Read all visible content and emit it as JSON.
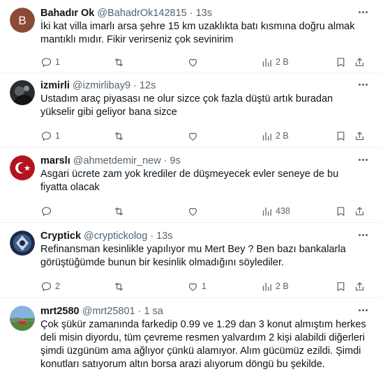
{
  "tweets": [
    {
      "name": "Bahadır Ok",
      "handle": "@BahadrOk142815",
      "time": "13s",
      "avatar_letter": "B",
      "text": "İki kat villa imarlı arsa şehre 15 km uzaklıkta batı kısmına doğru almak mantıklı mıdır. Fikir verirseniz çok sevinirim",
      "replies": "1",
      "retweets": "",
      "likes": "",
      "views": "2 B"
    },
    {
      "name": "izmirli",
      "handle": "@izmirlibay9",
      "time": "12s",
      "text": "Ustadım araç piyasası ne olur sizce çok fazla düştü artık buradan yükselir gibi geliyor bana sizce",
      "replies": "1",
      "retweets": "",
      "likes": "",
      "views": "2 B"
    },
    {
      "name": "marslı",
      "handle": "@ahmetdemir_new",
      "time": "9s",
      "text": "Asgari ücrete zam yok krediler de düşmeyecek evler seneye de bu fiyatta olacak",
      "replies": "",
      "retweets": "",
      "likes": "",
      "views": "438"
    },
    {
      "name": "Cryptick",
      "handle": "@cryptickolog",
      "time": "13s",
      "text": "Refinansman kesinlikle yapılıyor mu Mert Bey ? Ben bazı bankalarla görüştüğümde bunun bir kesinlik olmadığını söylediler.",
      "replies": "2",
      "retweets": "",
      "likes": "1",
      "views": "2 B"
    },
    {
      "name": "mrt2580",
      "handle": "@mrt25801",
      "time": "1 sa",
      "text": "Çok şükür zamanında farkedip 0.99 ve 1.29 dan 3 konut almıştım herkes deli misin diyordu, tüm çevreme resmen yalvardım 2 kişi alabildi diğerleri şimdi üzgünüm ama ağlıyor çünkü alamıyor. Alım gücümüz ezildi. Şimdi konutları satıyorum altın borsa arazi alıyorum döngü bu şekilde."
    }
  ],
  "colors": {
    "text": "#0f1419",
    "muted": "#536471",
    "divider": "#eff3f4",
    "avatar_b": "#8b4a36"
  },
  "icons": [
    "reply-icon",
    "retweet-icon",
    "like-icon",
    "views-icon",
    "bookmark-icon",
    "share-icon",
    "more-icon"
  ]
}
